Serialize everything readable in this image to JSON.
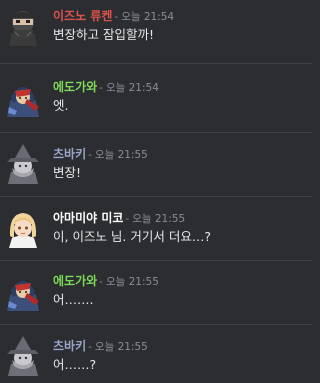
{
  "messages": [
    {
      "author": "이즈노 류켄",
      "author_color": "#e0524c",
      "sep": "-",
      "time": "오늘 21:54",
      "text": "변장하고 잠입할까!",
      "avatar_icon": "masked-ninja-avatar-icon"
    },
    {
      "author": "에도가와",
      "author_color": "#7ed957",
      "sep": "-",
      "time": "오늘 21:54",
      "text": "엣.",
      "avatar_icon": "hooded-character-avatar-icon"
    },
    {
      "author": "츠바키",
      "author_color": "#9aa6c8",
      "sep": "-",
      "time": "오늘 21:55",
      "text": "변장!",
      "avatar_icon": "witch-hat-avatar-icon"
    },
    {
      "author": "아마미야 미코",
      "author_color": "#ffffff",
      "sep": "-",
      "time": "오늘 21:55",
      "text": "이, 이즈노 님. 거기서 더요…?",
      "avatar_icon": "blonde-girl-avatar-icon"
    },
    {
      "author": "에도가와",
      "author_color": "#7ed957",
      "sep": "-",
      "time": "오늘 21:55",
      "text": "어…….",
      "avatar_icon": "hooded-character-avatar-icon"
    },
    {
      "author": "츠바키",
      "author_color": "#9aa6c8",
      "sep": "-",
      "time": "오늘 21:55",
      "text": "어……?",
      "avatar_icon": "witch-hat-avatar-icon"
    }
  ]
}
